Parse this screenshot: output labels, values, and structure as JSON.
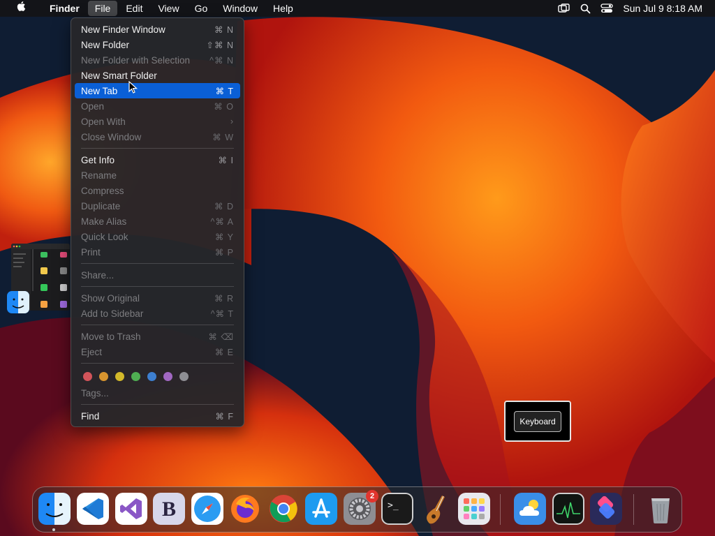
{
  "menubar": {
    "app": "Finder",
    "menus": [
      "File",
      "Edit",
      "View",
      "Go",
      "Window",
      "Help"
    ],
    "active_menu": "File",
    "clock": "Sun Jul 9  8:18 AM",
    "status_icons": [
      "screen-mirroring-icon",
      "spotlight-search-icon",
      "control-center-icon"
    ]
  },
  "file_menu": {
    "items": [
      {
        "label": "New Finder Window",
        "shortcut": "⌘ N",
        "enabled": true
      },
      {
        "label": "New Folder",
        "shortcut": "⇧⌘ N",
        "enabled": true
      },
      {
        "label": "New Folder with Selection",
        "shortcut": "^⌘ N",
        "enabled": false
      },
      {
        "label": "New Smart Folder",
        "shortcut": "",
        "enabled": true
      },
      {
        "label": "New Tab",
        "shortcut": "⌘ T",
        "enabled": true,
        "highlighted": true
      },
      {
        "label": "Open",
        "shortcut": "⌘ O",
        "enabled": false
      },
      {
        "label": "Open With",
        "shortcut": "›",
        "enabled": false
      },
      {
        "label": "Close Window",
        "shortcut": "⌘ W",
        "enabled": false
      },
      {
        "label": "Get Info",
        "shortcut": "⌘ I",
        "enabled": true
      },
      {
        "label": "Rename",
        "shortcut": "",
        "enabled": false
      },
      {
        "label": "Compress",
        "shortcut": "",
        "enabled": false
      },
      {
        "label": "Duplicate",
        "shortcut": "⌘ D",
        "enabled": false
      },
      {
        "label": "Make Alias",
        "shortcut": "^⌘ A",
        "enabled": false
      },
      {
        "label": "Quick Look",
        "shortcut": "⌘ Y",
        "enabled": false
      },
      {
        "label": "Print",
        "shortcut": "⌘ P",
        "enabled": false
      },
      {
        "label": "Share...",
        "shortcut": "",
        "enabled": false
      },
      {
        "label": "Show Original",
        "shortcut": "⌘ R",
        "enabled": false
      },
      {
        "label": "Add to Sidebar",
        "shortcut": "^⌘ T",
        "enabled": false
      },
      {
        "label": "Move to Trash",
        "shortcut": "⌘ ⌫",
        "enabled": false
      },
      {
        "label": "Eject",
        "shortcut": "⌘ E",
        "enabled": false
      },
      {
        "label": "Tags...",
        "shortcut": "",
        "enabled": false
      },
      {
        "label": "Find",
        "shortcut": "⌘ F",
        "enabled": true
      }
    ],
    "tag_colors": [
      "#d2545a",
      "#d9952f",
      "#d3b92a",
      "#4fae52",
      "#3d7fd0",
      "#a168c2",
      "#8e8e93"
    ]
  },
  "keyboard_popup": {
    "button_label": "Keyboard"
  },
  "dock": {
    "apps": [
      {
        "name": "Finder",
        "icon": "finder-icon"
      },
      {
        "name": "Visual Studio Code",
        "icon": "vscode-icon"
      },
      {
        "name": "Visual Studio",
        "icon": "visual-studio-icon"
      },
      {
        "name": "BBEdit",
        "icon": "bbedit-icon",
        "glyph": "B"
      },
      {
        "name": "Safari",
        "icon": "safari-icon"
      },
      {
        "name": "Firefox",
        "icon": "firefox-icon"
      },
      {
        "name": "Chrome",
        "icon": "chrome-icon"
      },
      {
        "name": "App Store",
        "icon": "app-store-icon"
      },
      {
        "name": "System Settings",
        "icon": "system-settings-icon",
        "badge": "2"
      },
      {
        "name": "Terminal",
        "icon": "terminal-icon",
        "glyph": ">_"
      },
      {
        "name": "GarageBand",
        "icon": "garageband-icon"
      },
      {
        "name": "Launchpad",
        "icon": "launchpad-icon"
      },
      {
        "name": "Weather",
        "icon": "weather-icon"
      },
      {
        "name": "Activity Monitor",
        "icon": "activity-monitor-icon"
      },
      {
        "name": "Shortcuts",
        "icon": "shortcuts-icon"
      },
      {
        "name": "Trash",
        "icon": "trash-icon"
      }
    ]
  },
  "colors": {
    "menu_highlight": "#0a5fd6",
    "badge": "#e2352e"
  }
}
